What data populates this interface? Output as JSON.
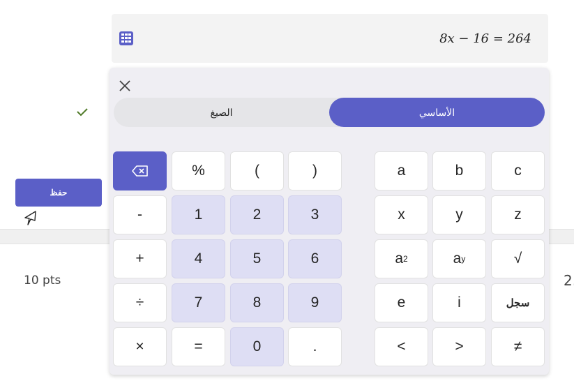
{
  "equation": {
    "value": "8x − 16 = 264"
  },
  "save_button": {
    "label": "حفظ"
  },
  "points": {
    "label": "10 pts"
  },
  "right_fragment": {
    "text": "2."
  },
  "tabs": [
    {
      "label": "الصيغ",
      "active": false
    },
    {
      "label": "الأساسي",
      "active": true
    }
  ],
  "ops_keys": [
    "%",
    "(",
    ")",
    "-",
    "+",
    "÷",
    "×",
    "=",
    "."
  ],
  "digit_keys": [
    "1",
    "2",
    "3",
    "4",
    "5",
    "6",
    "7",
    "8",
    "9",
    "0"
  ],
  "letter_keys": [
    "a",
    "b",
    "c",
    "x",
    "y",
    "z",
    "e",
    "i"
  ],
  "power_keys": {
    "square_base": "a",
    "square_exp": "2",
    "nth_base": "a",
    "nth_exp": "y"
  },
  "symbol_keys": {
    "sqrt": "√",
    "ne": "≠",
    "lt": "<",
    "gt": ">"
  },
  "text_keys": {
    "log": "سجل"
  },
  "colors": {
    "accent": "#5b5fc7",
    "digit_key_bg": "#dedef4",
    "panel_bg": "#efeef3",
    "check_green": "#4f7a28"
  },
  "icons": [
    "calculator-icon",
    "close-icon",
    "backspace-icon",
    "checkmark-icon",
    "pointer-cursor-icon"
  ]
}
